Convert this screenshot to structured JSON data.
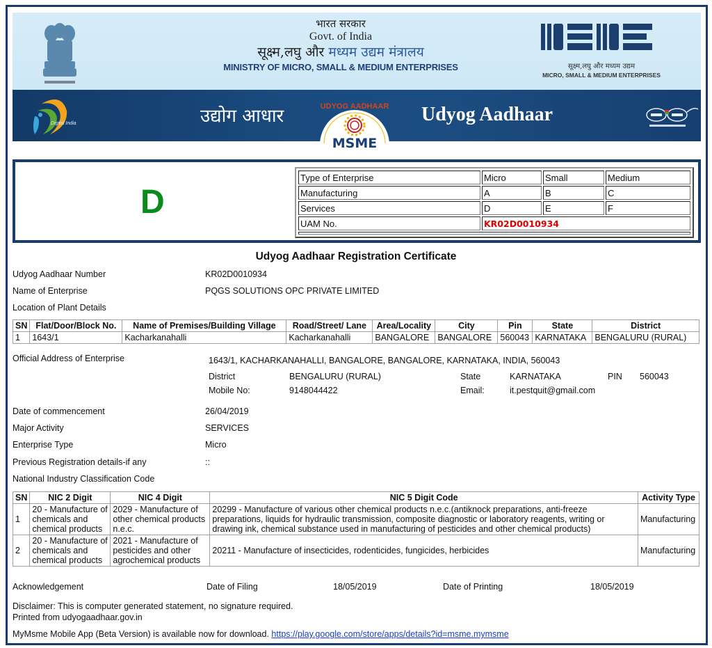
{
  "header": {
    "hindi_govt": "भारत सरकार",
    "govt_of_india": "Govt. of India",
    "hindi_ministry_part1": "सूक्ष्म,लघु और ",
    "hindi_ministry_part2": "मध्यम उद्यम मंत्रालय",
    "ministry_name": "MINISTRY OF MICRO, SMALL & MEDIUM ENTERPRISES",
    "msme_logo_hindi": "सूक्ष्म,लघु और मध्यम उद्यम",
    "msme_logo_english": "MICRO, SMALL & MEDIUM ENTERPRISES",
    "digital_india_label": "Digital India",
    "udyog_aadhaar_hindi": "उद्योग आधार",
    "udyog_aadhaar_english": "Udyog Aadhaar",
    "badge_arc_text": "UDYOG AADHAAR",
    "badge_bottom_text": "MSME",
    "colors": {
      "band": "#1a4a7e",
      "light_band": "#d6ecf8",
      "frame": "#173c6e"
    }
  },
  "code_box": {
    "category_letter": "D",
    "category_color": "#0a8a1a",
    "table": {
      "header": [
        "Type of Enterprise",
        "Micro",
        "Small",
        "Medium"
      ],
      "rows": [
        [
          "Manufacturing",
          "A",
          "B",
          "C"
        ],
        [
          "Services",
          "D",
          "E",
          "F"
        ]
      ],
      "uam_label": "UAM No.",
      "uam_value": "KR02D0010934",
      "uam_color": "#e10000"
    }
  },
  "certificate": {
    "title": "Udyog Aadhaar Registration Certificate",
    "fields": {
      "aadhaar_number_label": "Udyog Aadhaar Number",
      "aadhaar_number": "KR02D0010934",
      "enterprise_name_label": "Name of Enterprise",
      "enterprise_name": "PQGS SOLUTIONS OPC PRIVATE LIMITED",
      "plant_location_label": "Location of Plant Details"
    },
    "plant_table": {
      "columns": [
        "SN",
        "Flat/Door/Block No.",
        "Name of Premises/Building Village",
        "Road/Street/ Lane",
        "Area/Locality",
        "City",
        "Pin",
        "State",
        "District"
      ],
      "rows": [
        [
          "1",
          "1643/1",
          "Kacharkanahalli",
          "Kacharkanahalli",
          "BANGALORE",
          "BANGALORE",
          "560043",
          "KARNATAKA",
          "BENGALURU (RURAL)"
        ]
      ]
    },
    "official_address": {
      "label": "Official Address of Enterprise",
      "address": "1643/1, KACHARKANAHALLI, BANGALORE, BANGALORE, KARNATAKA, INDIA, 560043",
      "district_label": "District",
      "district": "BENGALURU (RURAL)",
      "state_label": "State",
      "state": "KARNATAKA",
      "pin_label": "PIN",
      "pin": "560043",
      "mobile_label": "Mobile No:",
      "mobile": "9148044422",
      "email_label": "Email:",
      "email": "it.pestquit@gmail.com"
    },
    "details": {
      "commencement_label": "Date of commencement",
      "commencement": "26/04/2019",
      "major_activity_label": "Major Activity",
      "major_activity": "SERVICES",
      "enterprise_type_label": "Enterprise Type",
      "enterprise_type": "Micro",
      "previous_reg_label": "Previous Registration details-if any",
      "previous_reg": "::",
      "nic_label": "National Industry Classification Code"
    },
    "nic_table": {
      "columns": [
        "SN",
        "NIC 2 Digit",
        "NIC 4 Digit",
        "NIC 5 Digit Code",
        "Activity Type"
      ],
      "rows": [
        [
          "1",
          "20 - Manufacture of chemicals and chemical products",
          "2029 - Manufacture of other chemical products n.e.c.",
          "20299 - Manufacture of various other chemical products n.e.c.(antiknock preparations, anti-freeze preparations, liquids for hydraulic transmission, composite diagnostic or laboratory reagents, writing or drawing ink, chemical substance used in manufacturing of pesticides and other chemical products)",
          "Manufacturing"
        ],
        [
          "2",
          "20 - Manufacture of chemicals and chemical products",
          "2021 - Manufacture of pesticides and other agrochemical products",
          "20211 - Manufacture of insecticides, rodenticides, fungicides, herbicides",
          "Manufacturing"
        ]
      ]
    },
    "footer": {
      "acknowledgement_label": "Acknowledgement",
      "filing_label": "Date of Filing",
      "filing_date": "18/05/2019",
      "printing_label": "Date of Printing",
      "printing_date": "18/05/2019",
      "disclaimer": "Disclaimer: This is computer generated statement, no signature required.",
      "printed_from": "Printed from udyogaadhaar.gov.in",
      "app_notice": "MyMsme Mobile App (Beta Version) is available now for download.",
      "app_link": "https://play.google.com/store/apps/details?id=msme.mymsme"
    }
  }
}
